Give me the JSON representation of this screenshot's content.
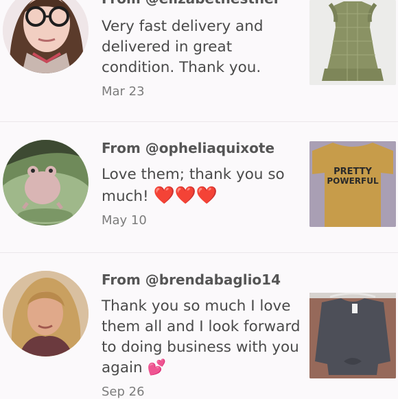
{
  "reviews": [
    {
      "from": "From @elizabethesther",
      "message": "Very fast delivery and delivered in great condition. Thank you.",
      "date": "Mar 23",
      "thumb_desc_icon": "green-gingham-dress"
    },
    {
      "from": "From @opheliaquixote",
      "message": "Love them; thank you so much!",
      "emoji": "❤️❤️❤️",
      "date": "May 10",
      "shirt_text_1": "PRETTY",
      "shirt_text_2": "POWERFUL"
    },
    {
      "from": "From @brendabaglio14",
      "message": "Thank you so much I love them all and I look forward to doing business with you again",
      "emoji": "💕",
      "date": "Sep 26"
    }
  ],
  "colors": {
    "background": "#fbf9fb",
    "divider": "#ebe7ea",
    "text": "#4a4a4a",
    "date": "#7c7c7c"
  }
}
